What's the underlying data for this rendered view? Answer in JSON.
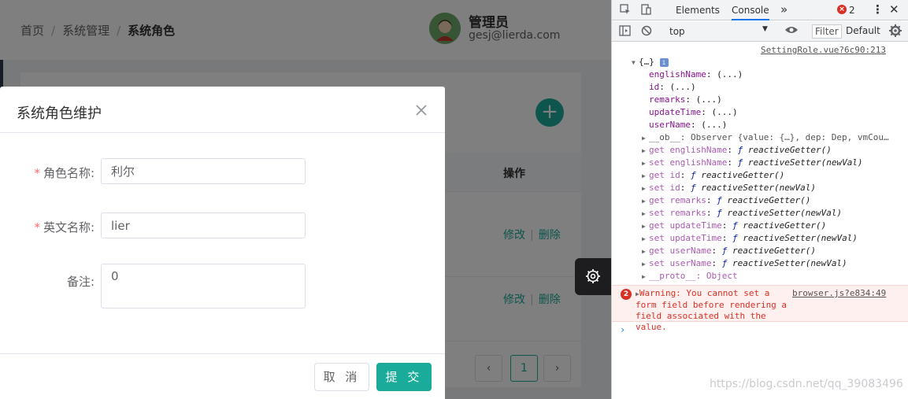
{
  "header": {
    "breadcrumb": [
      "首页",
      "系统管理",
      "系统角色"
    ],
    "user_name": "管理员",
    "user_email": "gesj@lierda.com"
  },
  "table": {
    "column_action": "操作",
    "rows": [
      {
        "edit": "修改",
        "delete": "删除"
      },
      {
        "edit": "修改",
        "delete": "删除"
      }
    ]
  },
  "pagination": {
    "prev": "‹",
    "page": "1",
    "next": "›"
  },
  "dialog": {
    "title": "系统角色维护",
    "fields": {
      "role_name_label": "角色名称:",
      "role_name_value": "利尔",
      "english_name_label": "英文名称:",
      "english_name_value": "lier",
      "remarks_label": "备注:",
      "remarks_value": "0"
    },
    "cancel": "取 消",
    "submit": "提 交"
  },
  "devtools": {
    "tabs": [
      "Elements",
      "Console"
    ],
    "active_tab": "Console",
    "error_count": "2",
    "context": "top",
    "filter_placeholder": "Filter",
    "levels": "Default",
    "source_link": "SettingRole.vue?6c90:213",
    "object_header": "{…}",
    "props": [
      {
        "key": "englishName",
        "val": "(...)"
      },
      {
        "key": "id",
        "val": "(...)"
      },
      {
        "key": "remarks",
        "val": "(...)"
      },
      {
        "key": "updateTime",
        "val": "(...)"
      },
      {
        "key": "userName",
        "val": "(...)"
      }
    ],
    "observer_line": "__ob__: Observer {value: {…}, dep: Dep, vmCou…",
    "accessors": [
      {
        "kind": "get",
        "name": "englishName",
        "fn": "reactiveGetter()"
      },
      {
        "kind": "set",
        "name": "englishName",
        "fn": "reactiveSetter(newVal)"
      },
      {
        "kind": "get",
        "name": "id",
        "fn": "reactiveGetter()"
      },
      {
        "kind": "set",
        "name": "id",
        "fn": "reactiveSetter(newVal)"
      },
      {
        "kind": "get",
        "name": "remarks",
        "fn": "reactiveGetter()"
      },
      {
        "kind": "set",
        "name": "remarks",
        "fn": "reactiveSetter(newVal)"
      },
      {
        "kind": "get",
        "name": "updateTime",
        "fn": "reactiveGetter()"
      },
      {
        "kind": "set",
        "name": "updateTime",
        "fn": "reactiveSetter(newVal)"
      },
      {
        "kind": "get",
        "name": "userName",
        "fn": "reactiveGetter()"
      },
      {
        "kind": "set",
        "name": "userName",
        "fn": "reactiveSetter(newVal)"
      }
    ],
    "proto_line": "__proto__: Object",
    "warning_count": "2",
    "warning_text": "Warning: You cannot set a form field before rendering a field associated with the value.",
    "warning_source": "browser.js?e834:49",
    "prompt": "›"
  },
  "watermark": "https://blog.csdn.net/qq_39083496",
  "colors": {
    "accent": "#1aab9b",
    "danger": "#f56c6c",
    "error": "#d93025"
  }
}
